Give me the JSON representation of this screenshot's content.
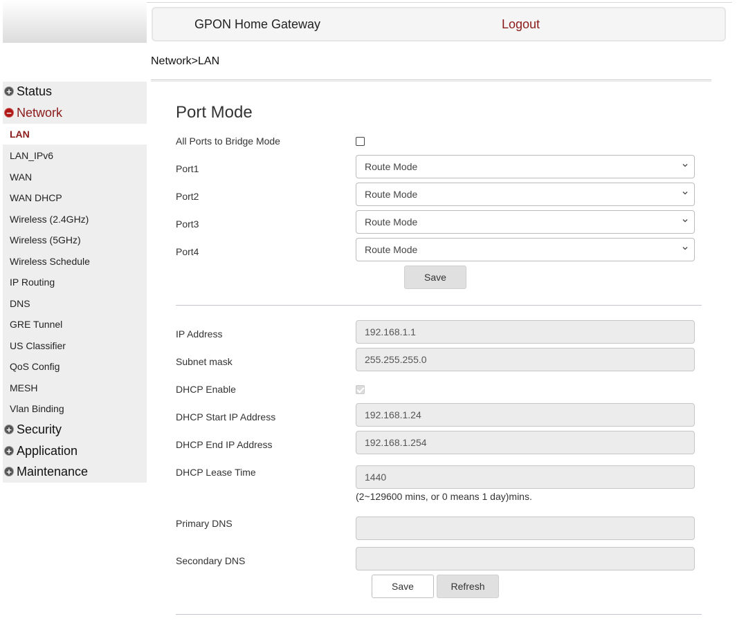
{
  "header": {
    "title": "GPON Home Gateway",
    "logout": "Logout"
  },
  "breadcrumb": "Network>LAN",
  "sidebar": {
    "categories": [
      {
        "label": "Status",
        "expanded": false
      },
      {
        "label": "Network",
        "expanded": true
      },
      {
        "label": "Security",
        "expanded": false
      },
      {
        "label": "Application",
        "expanded": false
      },
      {
        "label": "Maintenance",
        "expanded": false
      }
    ],
    "network_items": [
      "LAN",
      "LAN_IPv6",
      "WAN",
      "WAN DHCP",
      "Wireless (2.4GHz)",
      "Wireless (5GHz)",
      "Wireless Schedule",
      "IP Routing",
      "DNS",
      "GRE Tunnel",
      "US Classifier",
      "QoS Config",
      "MESH",
      "Vlan Binding"
    ],
    "selected": "LAN"
  },
  "port_mode": {
    "title": "Port Mode",
    "bridge_label": "All Ports to Bridge Mode",
    "bridge_checked": false,
    "ports": [
      {
        "label": "Port1",
        "value": "Route Mode"
      },
      {
        "label": "Port2",
        "value": "Route Mode"
      },
      {
        "label": "Port3",
        "value": "Route Mode"
      },
      {
        "label": "Port4",
        "value": "Route Mode"
      }
    ],
    "save": "Save"
  },
  "lan": {
    "ip_label": "IP Address",
    "ip": "192.168.1.1",
    "mask_label": "Subnet mask",
    "mask": "255.255.255.0",
    "dhcp_label": "DHCP Enable",
    "dhcp_checked": true,
    "start_label": "DHCP Start IP Address",
    "start": "192.168.1.24",
    "end_label": "DHCP End IP Address",
    "end": "192.168.1.254",
    "lease_label": "DHCP Lease Time",
    "lease": "1440",
    "lease_hint": "(2~129600 mins, or 0 means 1 day)mins.",
    "pdns_label": "Primary DNS",
    "pdns": "",
    "sdns_label": "Secondary DNS",
    "sdns": "",
    "save": "Save",
    "refresh": "Refresh"
  }
}
